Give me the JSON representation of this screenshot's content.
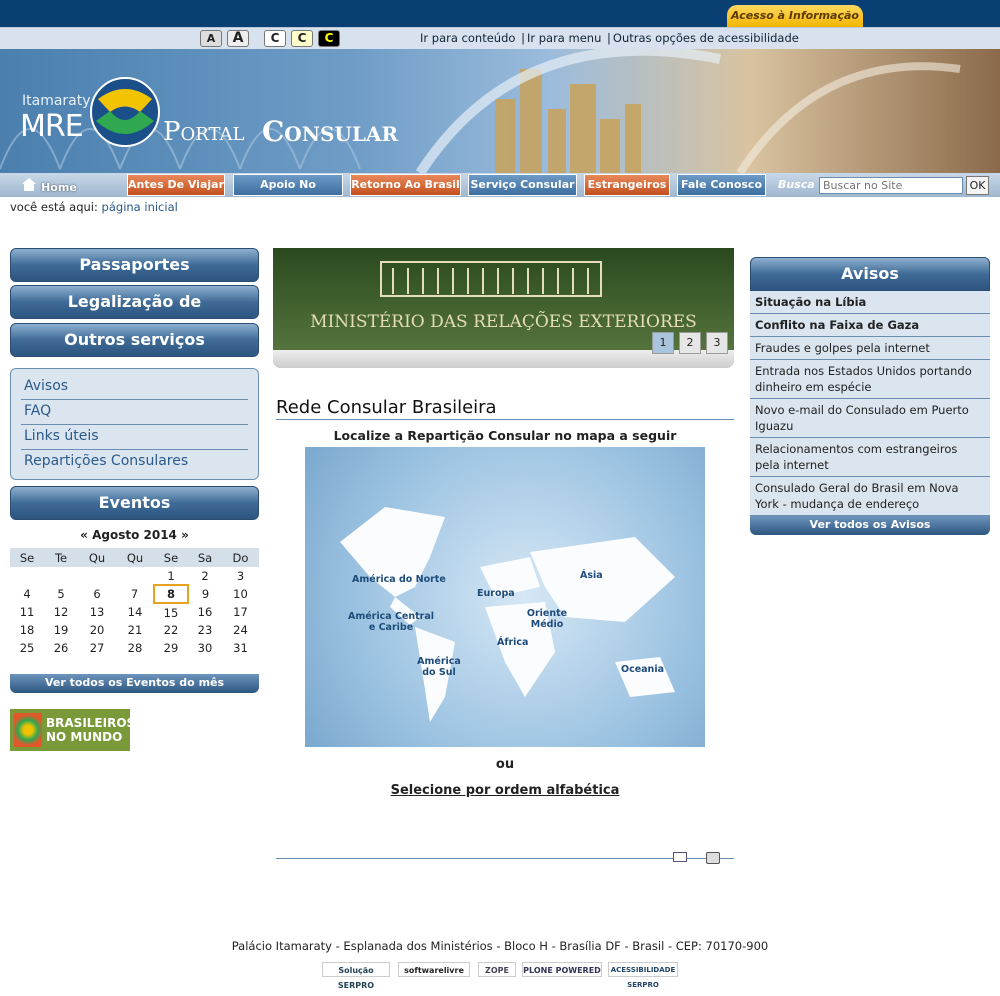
{
  "top": {
    "acesso_label": "Acesso à Informação"
  },
  "accessibility": {
    "font_small": "A",
    "font_large": "A",
    "contrast_1": "C",
    "contrast_2": "C",
    "contrast_3": "C",
    "links": [
      "Ir para conteúdo",
      "Ir para menu",
      "Outras opções de acessibilidade"
    ]
  },
  "banner": {
    "itamaraty": "Itamaraty",
    "mre": "MRE",
    "portal": "Portal",
    "consular": "Consular"
  },
  "nav": {
    "home": "Home",
    "items": [
      "Antes De Viajar",
      "Apoio No Exterior",
      "Retorno Ao Brasil",
      "Serviço Consular",
      "Estrangeiros",
      "Fale Conosco"
    ],
    "busca_label": "Busca",
    "search_placeholder": "Buscar no Site",
    "ok_label": "OK"
  },
  "breadcrumb": {
    "prefix": "você está aqui:",
    "link": "página inicial"
  },
  "sidebar": {
    "buttons": [
      "Passaportes",
      "Legalização de documentos",
      "Outros serviços"
    ],
    "links": [
      "Avisos",
      "FAQ",
      "Links úteis",
      "Repartições Consulares"
    ],
    "eventos_title": "Eventos"
  },
  "calendar": {
    "prev": "«",
    "month": "Agosto 2014",
    "next": "»",
    "weekdays": [
      "Se",
      "Te",
      "Qu",
      "Qu",
      "Se",
      "Sa",
      "Do"
    ],
    "weeks": [
      [
        "",
        "",
        "",
        "",
        "1",
        "2",
        "3"
      ],
      [
        "4",
        "5",
        "6",
        "7",
        "8",
        "9",
        "10"
      ],
      [
        "11",
        "12",
        "13",
        "14",
        "15",
        "16",
        "17"
      ],
      [
        "18",
        "19",
        "20",
        "21",
        "22",
        "23",
        "24"
      ],
      [
        "25",
        "26",
        "27",
        "28",
        "29",
        "30",
        "31"
      ]
    ],
    "today": "8",
    "ver_todos": "Ver todos os Eventos do mês"
  },
  "brasileiros": {
    "text": "BRASILEIROS NO MUNDO"
  },
  "slider": {
    "caption": "MINISTÉRIO DAS RELAÇÕES EXTERIORES",
    "pages": [
      "1",
      "2",
      "3"
    ],
    "active_page": 1
  },
  "main": {
    "title": "Rede Consular Brasileira",
    "subtitle": "Localize a Repartição Consular no mapa a seguir",
    "map_regions": [
      "América do Norte",
      "América Central e Caribe",
      "América do Sul",
      "Europa",
      "Ásia",
      "Oriente Médio",
      "África",
      "Oceania"
    ],
    "ou": "ou",
    "alpha_link": "Selecione por ordem alfabética"
  },
  "avisos": {
    "title": "Avisos",
    "items": [
      {
        "text": "Situação na Líbia",
        "bold": true
      },
      {
        "text": "Conflito na Faixa de Gaza",
        "bold": true
      },
      {
        "text": "Fraudes e golpes pela internet",
        "bold": false
      },
      {
        "text": "Entrada nos Estados Unidos portando dinheiro em espécie",
        "bold": false
      },
      {
        "text": "Novo e-mail do Consulado em Puerto Iguazu",
        "bold": false
      },
      {
        "text": "Relacionamentos com estrangeiros pela internet",
        "bold": false
      },
      {
        "text": "Consulado Geral do Brasil em Nova York - mudança de endereço",
        "bold": false
      }
    ],
    "ver_todos": "Ver todos os Avisos"
  },
  "footer": {
    "address": "Palácio Itamaraty - Esplanada dos Ministérios - Bloco H - Brasília DF - Brasil - CEP: 70170-900",
    "logos": [
      "Solução SERPRO",
      "softwarelivre",
      "ZOPE",
      "PLONE POWERED",
      "ACESSIBILIDADE SERPRO"
    ]
  }
}
